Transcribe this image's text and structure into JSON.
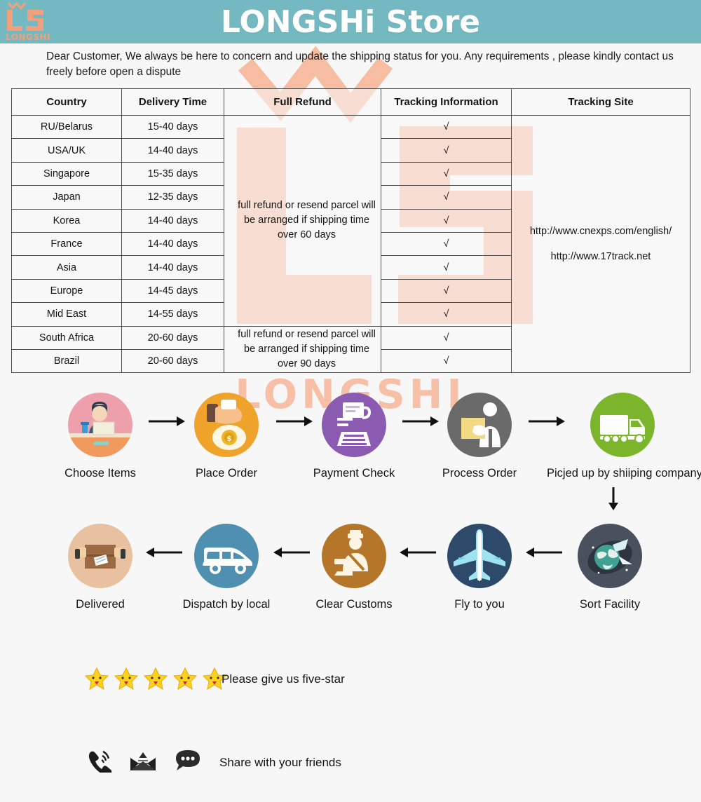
{
  "header": {
    "store_title": "LONGSHi Store",
    "logo_text": "LS",
    "logo_sub": "LONGSHI",
    "bg_color": "#74b9c2",
    "logo_color": "#f2a07b"
  },
  "watermark": {
    "text": "LONGSHI",
    "color": "#f6bda2"
  },
  "intro": {
    "text": "Dear Customer, We always be here to concern and update the shipping status for you.  Any requirements , please kindly contact us freely before open a dispute"
  },
  "table": {
    "headers": [
      "Country",
      "Delivery Time",
      "Full Refund",
      "Tracking Information",
      "Tracking Site"
    ],
    "rows": [
      {
        "country": "RU/Belarus",
        "delivery": "15-40 days",
        "tracking": "√"
      },
      {
        "country": "USA/UK",
        "delivery": "14-40 days",
        "tracking": "√"
      },
      {
        "country": "Singapore",
        "delivery": "15-35 days",
        "tracking": "√"
      },
      {
        "country": "Japan",
        "delivery": "12-35 days",
        "tracking": "√"
      },
      {
        "country": "Korea",
        "delivery": "14-40 days",
        "tracking": "√"
      },
      {
        "country": "France",
        "delivery": "14-40 days",
        "tracking": "√"
      },
      {
        "country": "Asia",
        "delivery": "14-40 days",
        "tracking": "√"
      },
      {
        "country": "Europe",
        "delivery": "14-45 days",
        "tracking": "√"
      },
      {
        "country": "Mid East",
        "delivery": "14-55 days",
        "tracking": "√"
      },
      {
        "country": "South Africa",
        "delivery": "20-60 days",
        "tracking": "√"
      },
      {
        "country": "Brazil",
        "delivery": "20-60 days",
        "tracking": "√"
      }
    ],
    "refund_60": "full refund or resend parcel will be arranged if shipping time over 60 days",
    "refund_90": "full refund or resend parcel will be arranged if shipping time over 90 days",
    "site_url_1": "http://www.cnexps.com/english/",
    "site_url_2": "http://www.17track.net"
  },
  "flow": {
    "row1": [
      {
        "label": "Choose Items",
        "icon": "person-at-desk-icon",
        "color": "#eda0ac"
      },
      {
        "label": "Place Order",
        "icon": "hand-coin-icon",
        "color": "#f0a32a"
      },
      {
        "label": "Payment Check",
        "icon": "payment-printer-icon",
        "color": "#8a5bb0"
      },
      {
        "label": "Process Order",
        "icon": "worker-box-icon",
        "color": "#6a6a6a"
      },
      {
        "label": "Picjed up by shiiping company",
        "icon": "truck-icon",
        "color": "#7ab52c"
      }
    ],
    "row2": [
      {
        "label": "Delivered",
        "icon": "open-box-icon",
        "color": "#e8c2a0"
      },
      {
        "label": "Dispatch by local",
        "icon": "van-icon",
        "color": "#4f8fb0"
      },
      {
        "label": "Clear Customs",
        "icon": "customs-officer-icon",
        "color": "#b5762a"
      },
      {
        "label": "Fly to you",
        "icon": "airplane-icon",
        "color": "#2e4a6b"
      },
      {
        "label": "Sort Facility",
        "icon": "globe-sort-icon",
        "color": "#4a515e"
      }
    ],
    "arrow_right": "arrow-right-icon",
    "arrow_left": "arrow-left-icon",
    "arrow_down": "arrow-down-icon"
  },
  "footer": {
    "star_count": 5,
    "star_color": "#ffd21e",
    "rating_text": "Please give us five-star",
    "share_text": "Share with your friends",
    "share_icons": [
      "phone-ringing-icon",
      "envelope-icon",
      "chat-bubble-icon"
    ]
  }
}
